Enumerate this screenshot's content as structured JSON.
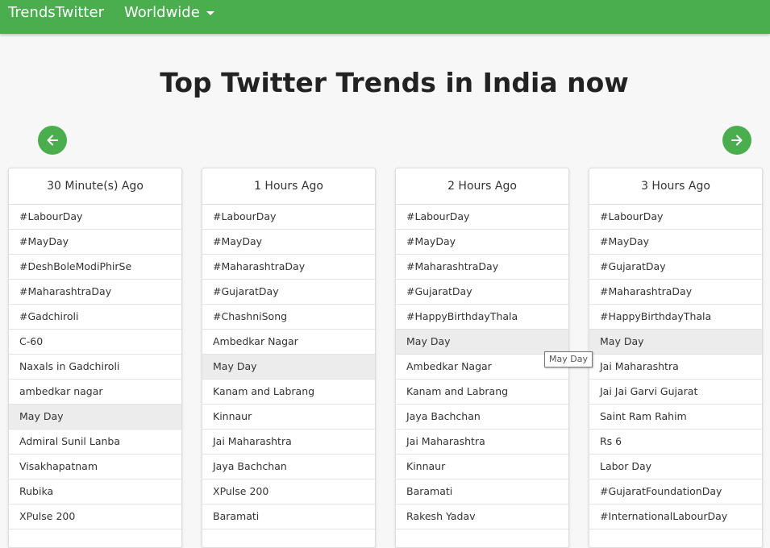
{
  "navbar": {
    "brand": "TrendsTwitter",
    "region": "Worldwide"
  },
  "page": {
    "title": "Top Twitter Trends in India now"
  },
  "colors": {
    "accent": "#4aae4f",
    "row_highlight": "#ececec"
  },
  "icons": {
    "prev": "arrow-left-icon",
    "next": "arrow-right-icon",
    "dropdown": "caret-down-icon"
  },
  "columns": [
    {
      "header": "30 Minute(s) Ago",
      "items": [
        "#LabourDay",
        "#MayDay",
        "#DeshBoleModiPhirSe",
        "#MaharashtraDay",
        "#Gadchiroli",
        "C-60",
        "Naxals in Gadchiroli",
        "ambedkar nagar",
        "May Day",
        "Admiral Sunil Lanba",
        "Visakhapatnam",
        "Rubika",
        "XPulse 200"
      ],
      "highlighted": "May Day"
    },
    {
      "header": "1 Hours Ago",
      "items": [
        "#LabourDay",
        "#MayDay",
        "#MaharashtraDay",
        "#GujaratDay",
        "#ChashniSong",
        "Ambedkar Nagar",
        "May Day",
        "Kanam and Labrang",
        "Kinnaur",
        "Jai Maharashtra",
        "Jaya Bachchan",
        "XPulse 200",
        "Baramati"
      ],
      "highlighted": "May Day"
    },
    {
      "header": "2 Hours Ago",
      "items": [
        "#LabourDay",
        "#MayDay",
        "#MaharashtraDay",
        "#GujaratDay",
        "#HappyBirthdayThala",
        "May Day",
        "Ambedkar Nagar",
        "Kanam and Labrang",
        "Jaya Bachchan",
        "Jai Maharashtra",
        "Kinnaur",
        "Baramati",
        "Rakesh Yadav"
      ],
      "highlighted": "May Day"
    },
    {
      "header": "3 Hours Ago",
      "items": [
        "#LabourDay",
        "#MayDay",
        "#GujaratDay",
        "#MaharashtraDay",
        "#HappyBirthdayThala",
        "May Day",
        "Jai Maharashtra",
        "Jai Jai Garvi Gujarat",
        "Saint Ram Rahim",
        "Rs 6",
        "Labor Day",
        "#GujaratFoundationDay",
        "#InternationalLabourDay"
      ],
      "highlighted": "May Day"
    }
  ],
  "tooltip": {
    "text": "May Day"
  }
}
